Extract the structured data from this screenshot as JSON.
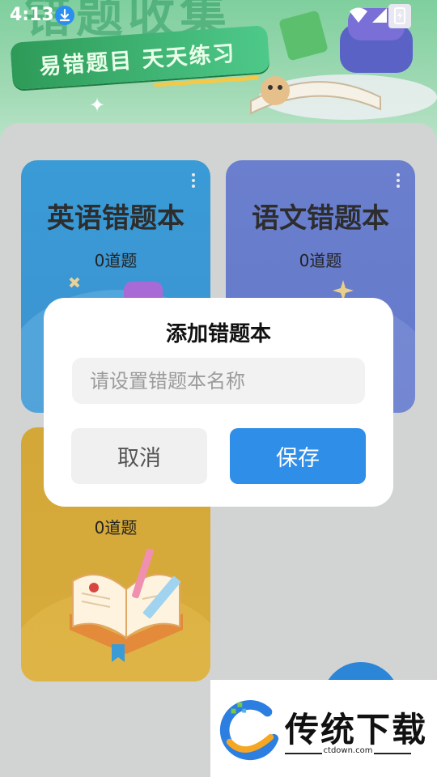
{
  "status_bar": {
    "time": "4:13"
  },
  "banner": {
    "big_title": "错题收集",
    "slogan": "易错题目 天天练习"
  },
  "cards": [
    {
      "title": "英语错题本",
      "count": "0道题"
    },
    {
      "title": "语文错题本",
      "count": "0道题"
    },
    {
      "title": "",
      "count": "0道题"
    }
  ],
  "dialog": {
    "title": "添加错题本",
    "input_placeholder": "请设置错题本名称",
    "input_value": "",
    "cancel_label": "取消",
    "save_label": "保存"
  },
  "watermark": {
    "brand": "传统下载",
    "url": "ctdown.com"
  },
  "colors": {
    "english_card": "#3a9bd6",
    "chinese_card": "#6a7fcd",
    "math_card": "#d4a838",
    "primary": "#2f8ee8",
    "fab": "#2c86d8"
  }
}
